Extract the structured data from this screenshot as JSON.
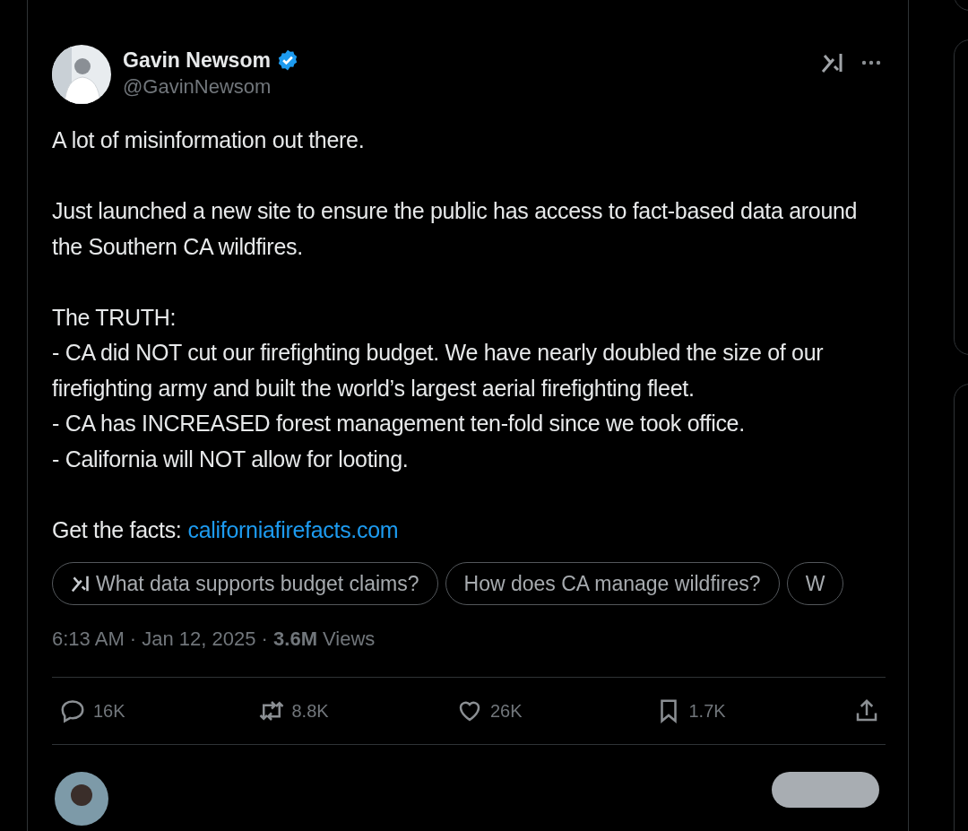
{
  "author": {
    "name": "Gavin Newsom",
    "handle": "@GavinNewsom",
    "verified": true
  },
  "paragraphs": [
    [
      "A lot of misinformation out there."
    ],
    [
      "Just launched a new site to ensure the public has access to fact-based data around the Southern CA wildfires."
    ],
    [
      "The TRUTH:",
      "- CA did NOT cut our firefighting budget. We have nearly doubled the size of our firefighting army and built the world’s largest aerial firefighting fleet.",
      "- CA has INCREASED forest management ten-fold since we took office.",
      "- California will NOT allow for looting."
    ]
  ],
  "facts": {
    "label": "Get the facts:",
    "link": "californiafirefacts.com"
  },
  "suggestions": [
    {
      "text": "What data supports budget claims?",
      "grok": true
    },
    {
      "text": "How does CA manage wildfires?",
      "grok": false
    },
    {
      "text": "W",
      "grok": false
    }
  ],
  "meta": "6:13 AM · Jan 12, 2025 · **3.6M** Views",
  "actions": [
    {
      "kind": "reply",
      "count": "16K"
    },
    {
      "kind": "repost",
      "count": "8.8K"
    },
    {
      "kind": "like",
      "count": "26K"
    },
    {
      "kind": "bookmark",
      "count": "1.7K"
    },
    {
      "kind": "share"
    }
  ]
}
